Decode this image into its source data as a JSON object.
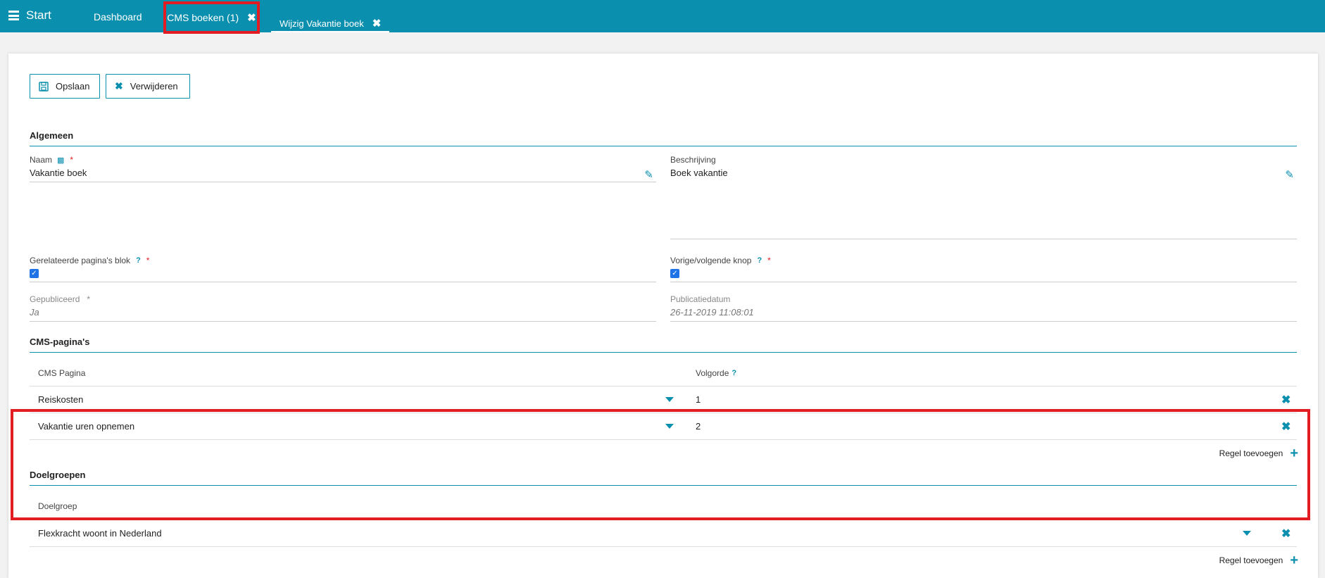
{
  "topbar": {
    "start_label": "Start",
    "tabs": [
      {
        "label": "Dashboard"
      },
      {
        "label": "CMS boeken (1)"
      },
      {
        "label": "Wijzig Vakantie boek"
      }
    ],
    "close_glyph": "✖"
  },
  "toolbar": {
    "save_label": "Opslaan",
    "delete_label": "Verwijderen"
  },
  "algemeen": {
    "title": "Algemeen",
    "naam_label": "Naam",
    "naam_value": "Vakantie boek",
    "beschrijving_label": "Beschrijving",
    "beschrijving_value": "Boek vakantie",
    "gerelateerde_label": "Gerelateerde pagina's blok",
    "vorige_label": "Vorige/volgende knop",
    "gepubliceerd_label": "Gepubliceerd",
    "gepubliceerd_value": "Ja",
    "publicatiedatum_label": "Publicatiedatum",
    "publicatiedatum_value": "26-11-2019 11:08:01",
    "required_mark": "*",
    "help_mark": "?"
  },
  "cms_paginas": {
    "title": "CMS-pagina's",
    "col_pagina": "CMS Pagina",
    "col_volgorde": "Volgorde",
    "rows": [
      {
        "pagina": "Reiskosten",
        "volgorde": "1"
      },
      {
        "pagina": "Vakantie uren opnemen",
        "volgorde": "2"
      }
    ],
    "add_label": "Regel toevoegen"
  },
  "doelgroepen": {
    "title": "Doelgroepen",
    "col_doelgroep": "Doelgroep",
    "rows": [
      {
        "doelgroep": "Flexkracht woont in Nederland"
      }
    ],
    "add_label": "Regel toevoegen"
  },
  "colors": {
    "accent": "#0a8fae",
    "highlight": "#e31c23",
    "required": "#e31c23"
  }
}
